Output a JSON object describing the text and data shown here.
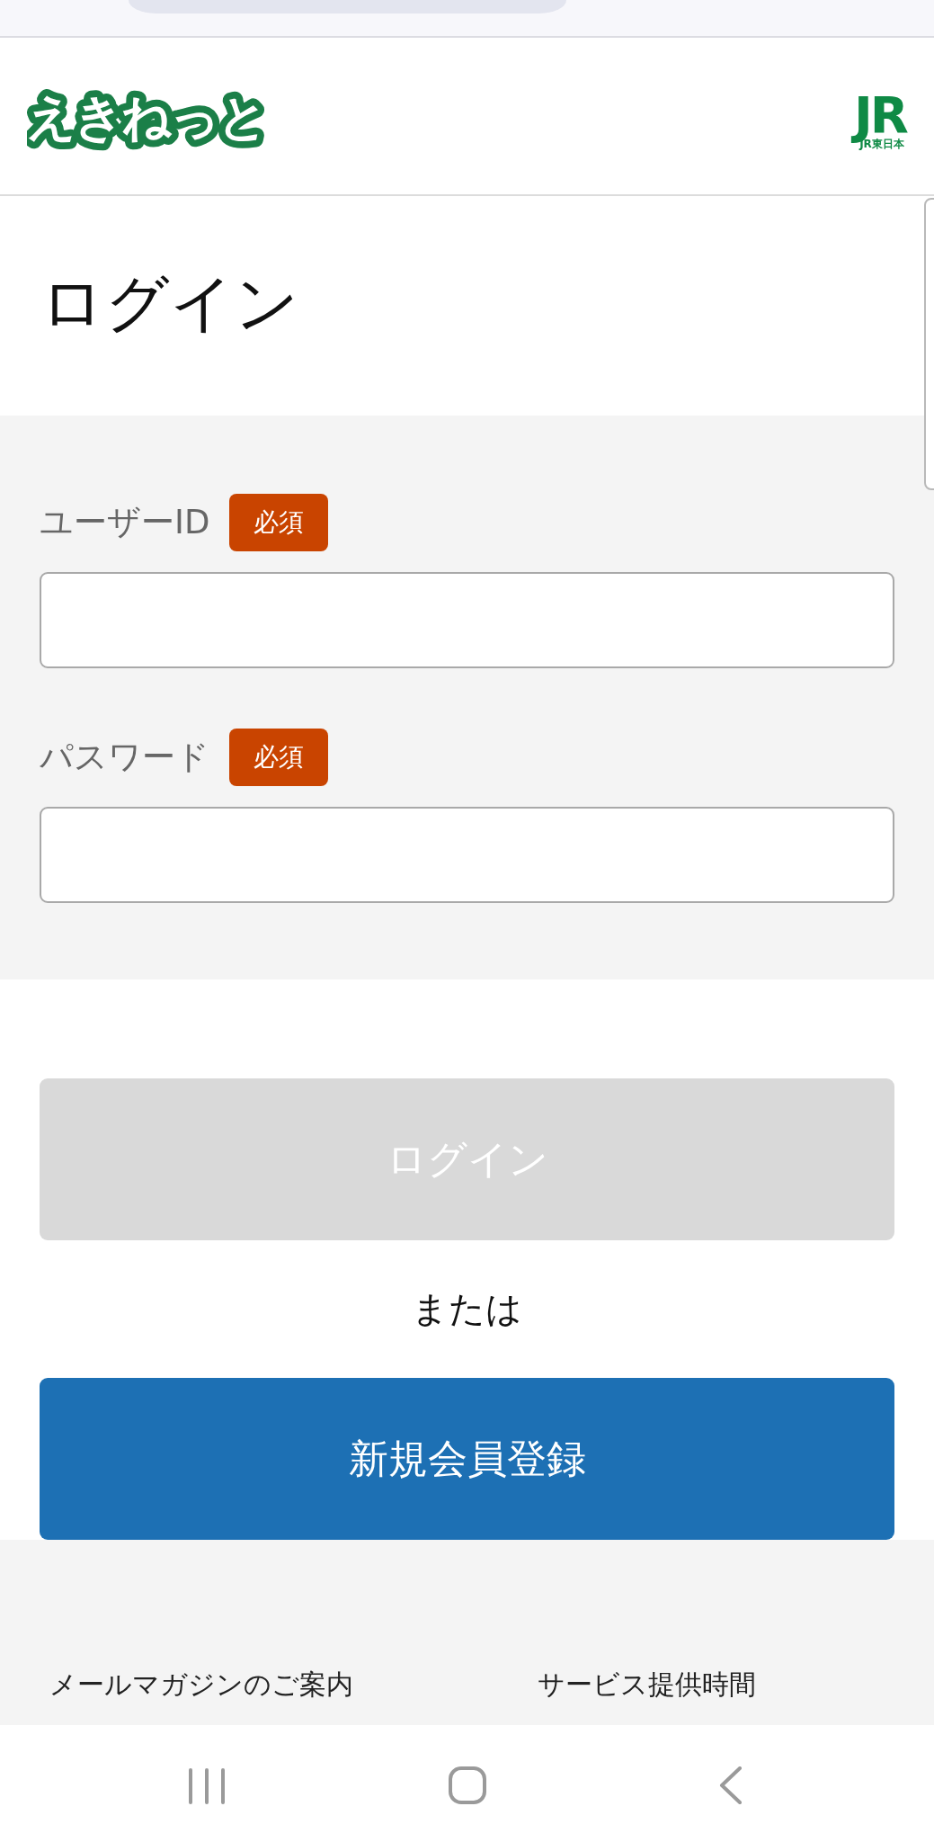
{
  "header": {
    "logo": "えきねっと",
    "brand_mark": "JR",
    "brand_caption": "JR東日本"
  },
  "page_title": "ログイン",
  "fields": [
    {
      "label": "ユーザーID",
      "badge": "必須"
    },
    {
      "label": "パスワード",
      "badge": "必須"
    }
  ],
  "login_button": {
    "label": "ログイン",
    "disabled": true
  },
  "separator": "または",
  "register_button": {
    "label": "新規会員登録"
  },
  "footer_links": [
    "メールマガジンのご案内",
    "サービス提供時間"
  ]
}
